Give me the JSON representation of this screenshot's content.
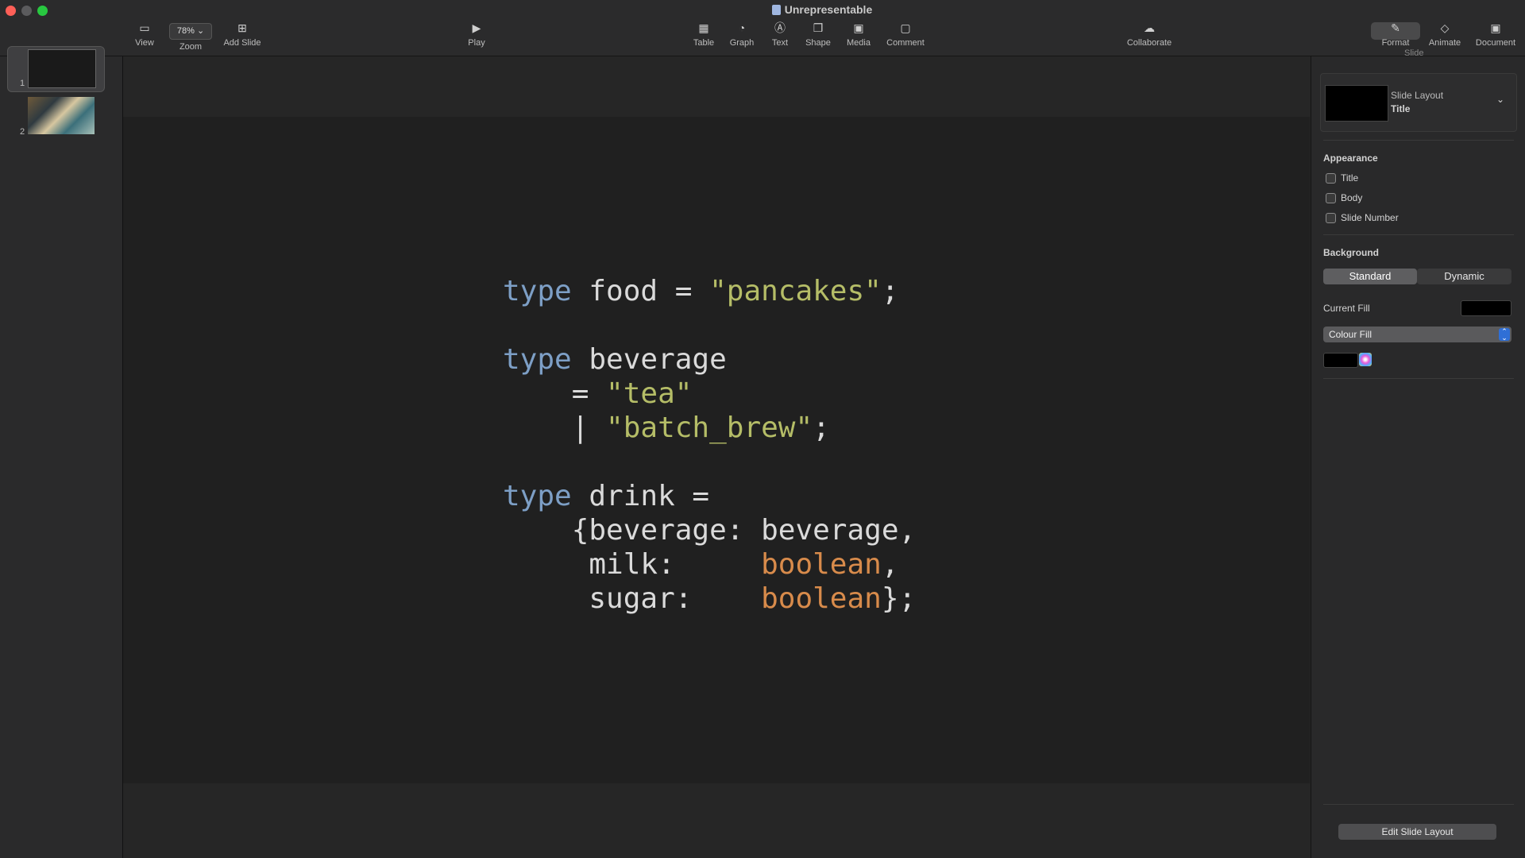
{
  "window": {
    "title": "Unrepresentable"
  },
  "toolbar": {
    "view": "View",
    "zoom_value": "78%",
    "zoom": "Zoom",
    "add_slide": "Add Slide",
    "play": "Play",
    "table": "Table",
    "graph": "Graph",
    "text": "Text",
    "shape": "Shape",
    "media": "Media",
    "comment": "Comment",
    "collaborate": "Collaborate",
    "format": "Format",
    "animate": "Animate",
    "document": "Document"
  },
  "navigator": {
    "slides": [
      {
        "number": "1"
      },
      {
        "number": "2"
      }
    ]
  },
  "slide": {
    "code": {
      "l1_kw": "type",
      "l1_rest": " food = ",
      "l1_str": "\"pancakes\"",
      "l1_end": ";",
      "l2_kw": "type",
      "l2_rest": " beverage",
      "l3_pre": "    = ",
      "l3_str": "\"tea\"",
      "l4_pre": "    | ",
      "l4_str": "\"batch_brew\"",
      "l4_end": ";",
      "l5_kw": "type",
      "l5_rest": " drink =",
      "l6": "    {beverage: beverage,",
      "l7_pre": "     milk:     ",
      "l7_bool": "boolean",
      "l7_end": ",",
      "l8_pre": "     sugar:    ",
      "l8_bool": "boolean",
      "l8_end": "};"
    }
  },
  "inspector": {
    "tab_partial": "Slide",
    "slide_layout_label": "Slide Layout",
    "slide_layout_value": "Title",
    "appearance": "Appearance",
    "title_cb": "Title",
    "body_cb": "Body",
    "slide_number_cb": "Slide Number",
    "background": "Background",
    "standard": "Standard",
    "dynamic": "Dynamic",
    "current_fill": "Current Fill",
    "fill_type": "Colour Fill",
    "edit_layout": "Edit Slide Layout"
  },
  "colors": {
    "keyword": "#7d9fc6",
    "string": "#b5bd67",
    "boolean": "#d88b4b",
    "accent": "#2f6fd6"
  }
}
